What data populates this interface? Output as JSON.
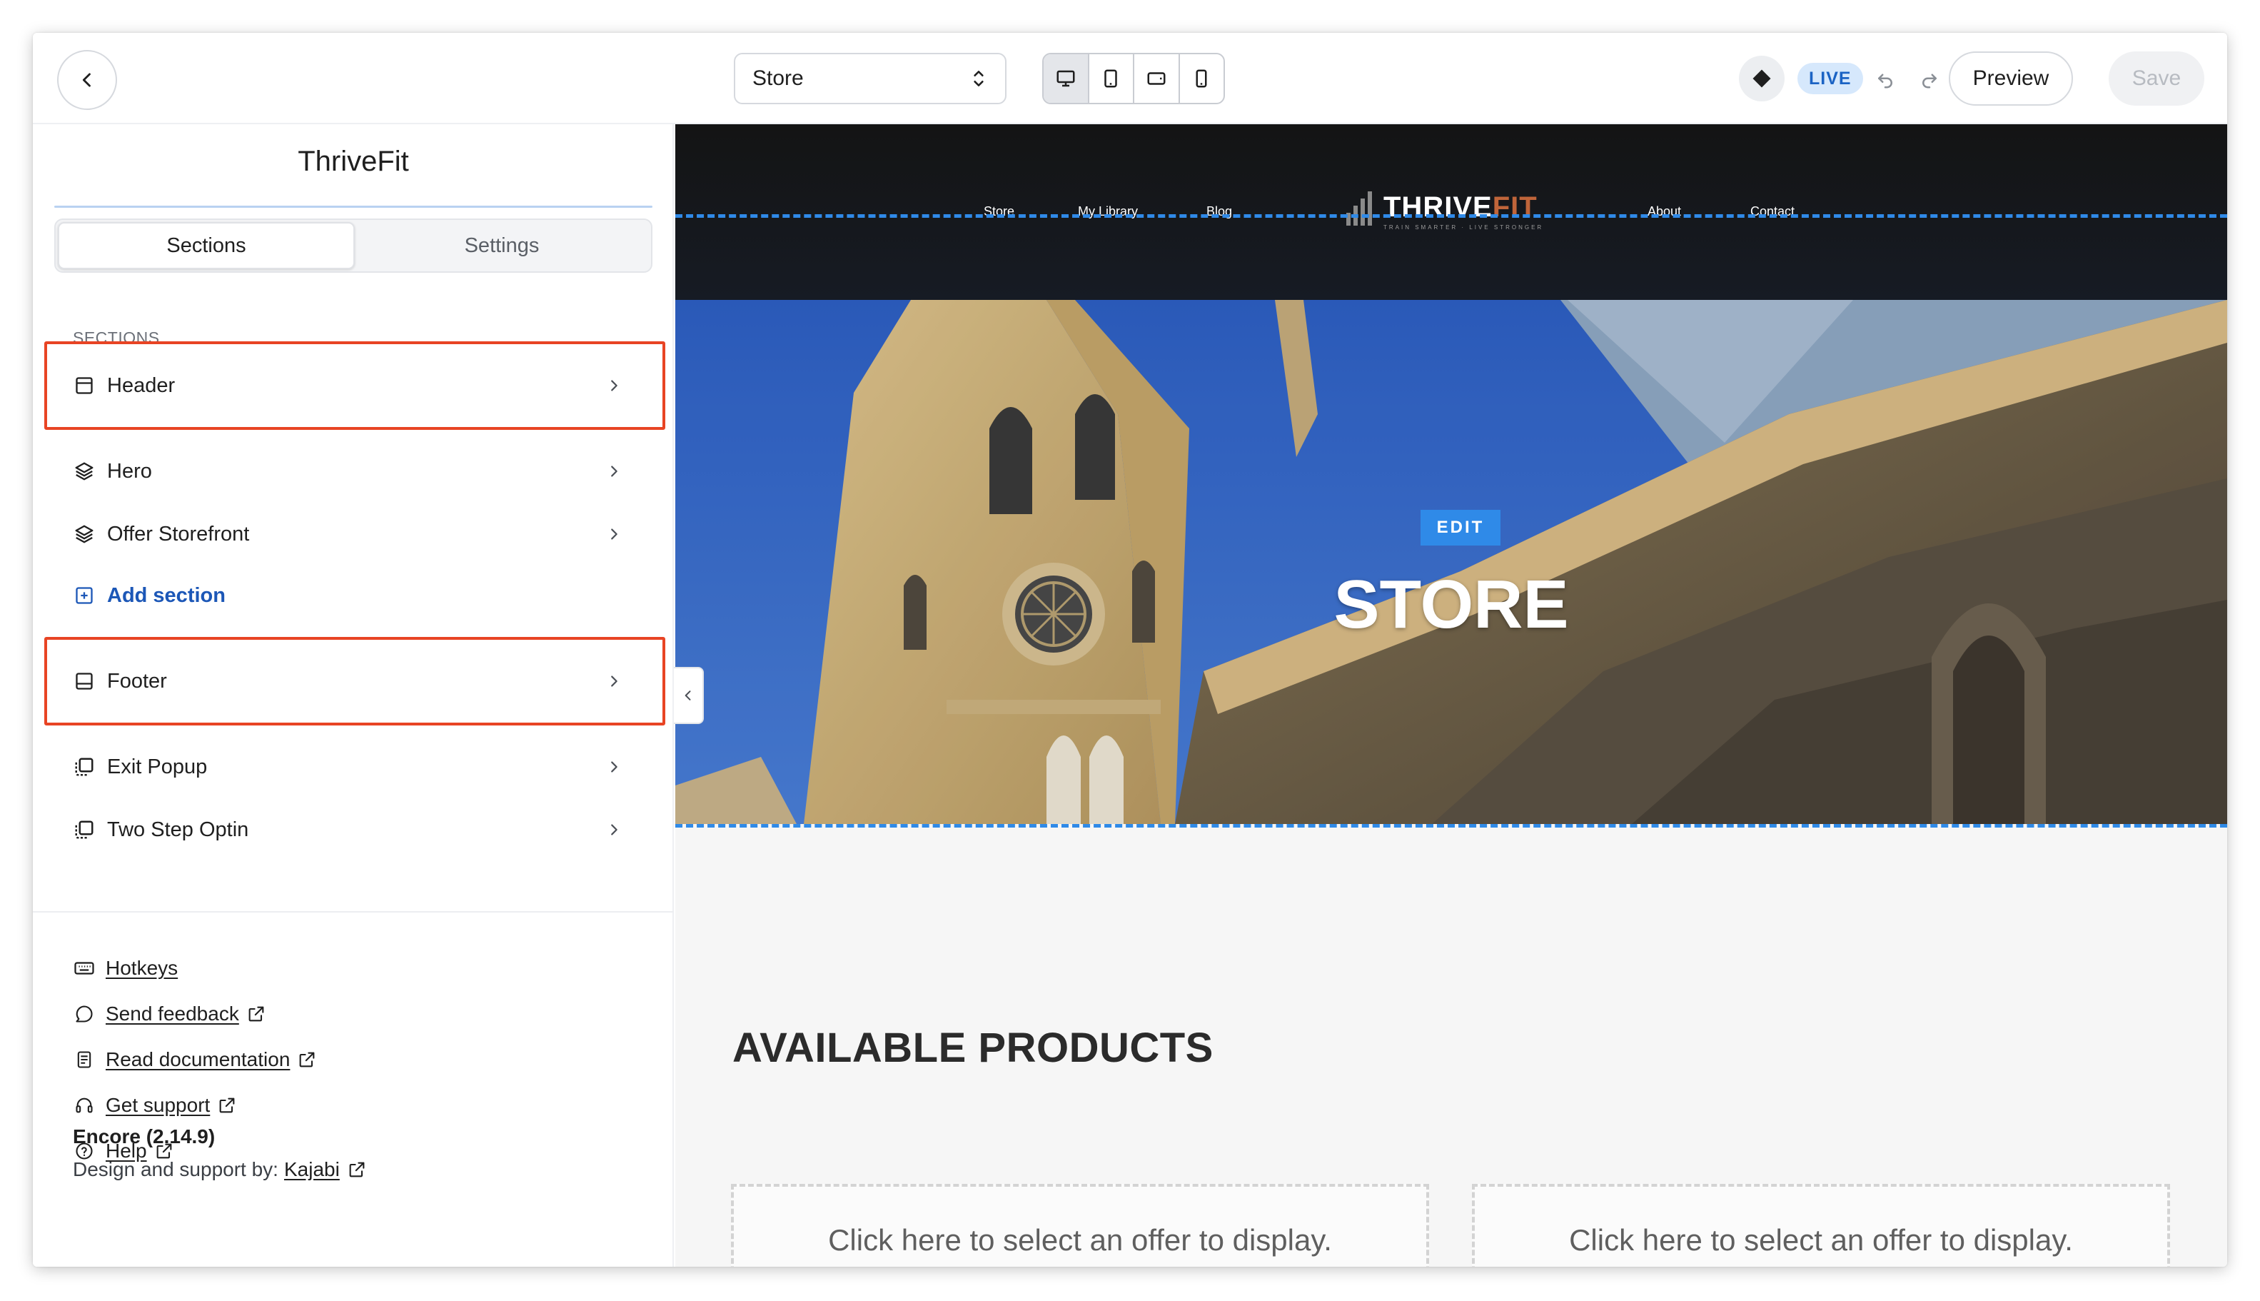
{
  "topbar": {
    "page_select_value": "Store",
    "live_badge": "LIVE",
    "preview_label": "Preview",
    "save_label": "Save"
  },
  "sidebar": {
    "site_title": "ThriveFit",
    "tabs": [
      "Sections",
      "Settings"
    ],
    "sections_label": "SECTIONS",
    "items": [
      {
        "label": "Header",
        "icon": "layout-icon"
      },
      {
        "label": "Hero",
        "icon": "layers-icon"
      },
      {
        "label": "Offer Storefront",
        "icon": "layers-icon"
      },
      {
        "label": "Add section",
        "icon": "plus-square-icon"
      },
      {
        "label": "Footer",
        "icon": "layout-icon"
      },
      {
        "label": "Exit Popup",
        "icon": "popup-icon"
      },
      {
        "label": "Two Step Optin",
        "icon": "popup-icon"
      }
    ],
    "footer_links": [
      {
        "label": "Hotkeys",
        "icon": "keyboard-icon",
        "external": false
      },
      {
        "label": "Send feedback",
        "icon": "chat-icon",
        "external": true
      },
      {
        "label": "Read documentation",
        "icon": "document-icon",
        "external": true
      },
      {
        "label": "Get support",
        "icon": "headset-icon",
        "external": true
      },
      {
        "label": "Help",
        "icon": "question-icon",
        "external": true
      }
    ],
    "version": "Encore (2.14.9)",
    "credit_prefix": "Design and support by:",
    "credit_link": "Kajabi"
  },
  "preview": {
    "nav": [
      "Store",
      "My Library",
      "Blog",
      "About",
      "Contact"
    ],
    "logo_main": "THRIVE",
    "logo_accent": "FIT",
    "logo_tagline": "TRAIN SMARTER · LIVE STRONGER",
    "edit_badge": "EDIT",
    "hero_title": "STORE",
    "products_title": "AVAILABLE PRODUCTS",
    "offer_placeholder": "Click here to select an offer to display."
  },
  "colors": {
    "accent_blue": "#2f8ae8",
    "highlight_red": "#e84424",
    "live_badge_bg": "#d6e8fc",
    "logo_accent": "#c0653a"
  }
}
